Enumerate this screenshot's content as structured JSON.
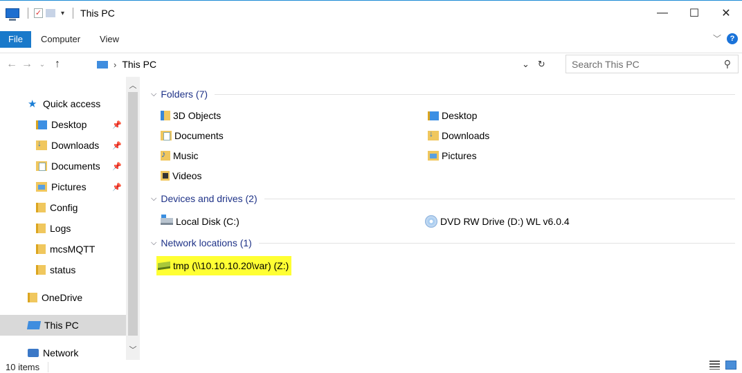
{
  "window": {
    "title": "This PC",
    "controls": {
      "minimize": "—",
      "maximize": "☐",
      "close": "✕"
    }
  },
  "ribbon": {
    "tabs": [
      {
        "label": "File"
      },
      {
        "label": "Computer"
      },
      {
        "label": "View"
      }
    ],
    "help": "?"
  },
  "address": {
    "breadcrumb": "This PC",
    "search_placeholder": "Search This PC"
  },
  "navpane": {
    "items": [
      {
        "label": "Quick access",
        "icon": "star-icon",
        "pinned": false
      },
      {
        "label": "Desktop",
        "icon": "desktop-folder-icon",
        "pinned": true
      },
      {
        "label": "Downloads",
        "icon": "downloads-folder-icon",
        "pinned": true
      },
      {
        "label": "Documents",
        "icon": "documents-folder-icon",
        "pinned": true
      },
      {
        "label": "Pictures",
        "icon": "pictures-folder-icon",
        "pinned": true
      },
      {
        "label": "Config",
        "icon": "folder-icon",
        "pinned": false
      },
      {
        "label": "Logs",
        "icon": "folder-icon",
        "pinned": false
      },
      {
        "label": "mcsMQTT",
        "icon": "folder-icon",
        "pinned": false
      },
      {
        "label": "status",
        "icon": "folder-icon",
        "pinned": false
      },
      {
        "label": "OneDrive",
        "icon": "folder-icon",
        "pinned": false
      },
      {
        "label": "This PC",
        "icon": "this-pc-icon",
        "selected": true
      },
      {
        "label": "Network",
        "icon": "network-icon",
        "pinned": false
      }
    ]
  },
  "content": {
    "groups": [
      {
        "label": "Folders (7)"
      },
      {
        "label": "Devices and drives (2)"
      },
      {
        "label": "Network locations (1)"
      }
    ],
    "folders": [
      {
        "label": "3D Objects",
        "icon": "3d-objects-icon"
      },
      {
        "label": "Desktop",
        "icon": "desktop-folder-icon"
      },
      {
        "label": "Documents",
        "icon": "documents-folder-icon"
      },
      {
        "label": "Downloads",
        "icon": "downloads-folder-icon"
      },
      {
        "label": "Music",
        "icon": "music-folder-icon"
      },
      {
        "label": "Pictures",
        "icon": "pictures-folder-icon"
      },
      {
        "label": "Videos",
        "icon": "videos-folder-icon"
      }
    ],
    "drives": [
      {
        "label": "Local Disk (C:)",
        "icon": "local-disk-icon"
      },
      {
        "label": "DVD RW Drive (D:) WL v6.0.4",
        "icon": "dvd-drive-icon"
      }
    ],
    "network": [
      {
        "label": "tmp (\\\\10.10.10.20\\var) (Z:)",
        "icon": "network-drive-icon",
        "highlight": "#ffff33"
      }
    ]
  },
  "status": {
    "count": "10 items"
  }
}
